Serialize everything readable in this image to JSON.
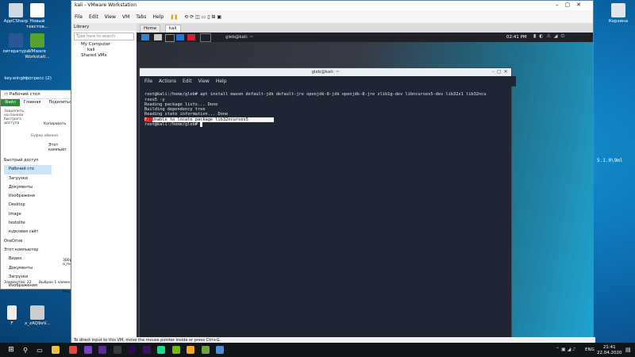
{
  "desktop": {
    "icons_left": [
      {
        "label": "AppCSharp",
        "color": "#cfd8e3"
      },
      {
        "label": "Новый текстов...",
        "color": "#ffffff"
      },
      {
        "label": "литература",
        "color": "#2b5797"
      },
      {
        "label": "VMware Workstati...",
        "color": "#5aa02c"
      },
      {
        "label": "key.winght",
        "color": "#eeeeee"
      },
      {
        "label": "прогресс (2)",
        "color": "#eeeeee"
      },
      {
        "label": "F",
        "color": "#eeeeee"
      },
      {
        "label": "x_zAQ9eV...",
        "color": "#cccccc"
      }
    ],
    "recycle_bin": "Корзина",
    "right_text": "5.1.0\\9ml"
  },
  "explorer": {
    "breadcrumb": "Рабочий стол",
    "tabs": [
      "Файл",
      "Главная",
      "Поделиться"
    ],
    "ribbon": {
      "pin": "Закрепить на панели быстрого доступа",
      "copy": "Копировать",
      "paste": "Вставить",
      "clipboard": "Буфер обмена"
    },
    "address": "Этот компьют",
    "nav": [
      "Быстрый доступ",
      "Рабочий сто",
      "Загрузки",
      "Документы",
      "Изображени",
      "Desktop",
      "Image",
      "textolite",
      "курсовая сайт",
      "OneDrive",
      "Этот компьютер",
      "Видео",
      "Документы",
      "Загрузки",
      "Изображения"
    ],
    "file_labels": [
      "300p",
      "o_me",
      "Pesci"
    ],
    "status": "Элементов: 22",
    "status2": "Выбран 1 элемен"
  },
  "vmware": {
    "title": "kali - VMware Workstation",
    "menu": [
      "File",
      "Edit",
      "View",
      "VM",
      "Tabs",
      "Help"
    ],
    "library": {
      "header": "Library",
      "search_placeholder": "Type here to search",
      "tree": [
        "My Computer",
        "kali",
        "Shared VMs"
      ]
    },
    "tabs": [
      {
        "label": "Home"
      },
      {
        "label": "kali"
      }
    ],
    "status": "To direct input to this VM, move the mouse pointer inside or press Ctrl+G."
  },
  "kali": {
    "panel_task": "gleb@kali: ~",
    "clock": "02:41 PM",
    "terminal": {
      "title": "gleb@kali: ~",
      "menu": [
        "File",
        "Actions",
        "Edit",
        "View",
        "Help"
      ],
      "lines": [
        "root@kali:/home/gleb# apt install maven default-jdk default-jre openjdk-8-jdk openjdk-8-jre zlib1g-dev libncurses5-dev lib32z1 lib32ncu",
        "rses5 -y",
        "Reading package lists... Done",
        "Building dependency tree",
        "Reading state information... Done"
      ],
      "error_prefix": "E: ",
      "error_text": "Unable to locate package lib32ncurses5",
      "prompt": "root@kali:/home/gleb# "
    }
  },
  "taskbar": {
    "lang": "ENG",
    "time": "21:41",
    "date": "22.04.2020",
    "apps": [
      {
        "name": "chrome-icon",
        "color": "#e8453c"
      },
      {
        "name": "vs-icon",
        "color": "#7b3fc4"
      },
      {
        "name": "vs2-icon",
        "color": "#5c2d91"
      },
      {
        "name": "sublime-icon",
        "color": "#3a3a3a"
      },
      {
        "name": "pr-icon",
        "color": "#2a0a4a"
      },
      {
        "name": "pr2-icon",
        "color": "#3a1060"
      },
      {
        "name": "pycharm-icon",
        "color": "#21d789"
      },
      {
        "name": "nvidia-icon",
        "color": "#76b900"
      },
      {
        "name": "colors-icon",
        "color": "#f5a623"
      },
      {
        "name": "vmware-icon",
        "color": "#6fa33b"
      },
      {
        "name": "task-icon",
        "color": "#4a90d9"
      }
    ]
  }
}
